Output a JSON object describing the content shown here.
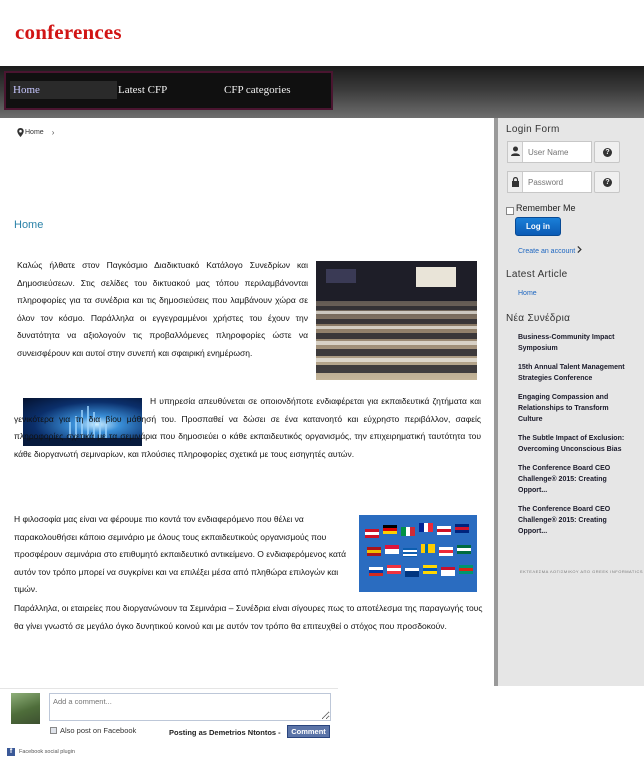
{
  "header": {
    "logo_text": "conferences"
  },
  "nav": {
    "items": [
      "Home",
      "Latest CFP",
      "CFP categories"
    ]
  },
  "breadcrumb": {
    "items": [
      "Home"
    ],
    "separator": "›"
  },
  "main": {
    "title": "Home",
    "paragraphs": [
      "Καλώς ήλθατε στον Παγκόσμιο Διαδικτυακό Κατάλογο Συνεδρίων και Δημοσιεύσεων. Στις σελίδες του δικτυακού μας τόπου περιλαμβάνονται πληροφορίες για τα συνέδρια και τις δημοσιεύσεις που λαμβάνουν χώρα σε όλον τον κόσμο. Παράλληλα οι εγγεγραμμένοι χρήστες του έχουν την δυνατότητα να αξιολογούν τις προβαλλόμενες πληροφορίες ώστε να συνεισφέρουν και αυτοί στην συνεπή και σφαιρική ενημέρωση.",
      "Η υπηρεσία απευθύνεται σε οποιονδήποτε ενδιαφέρεται για εκπαιδευτικά ζητήματα και γενικότερα για τη δια βίου μάθησή του. Προσπαθεί να δώσει σε ένα κατανοητό και εύχρηστο περιβάλλον, σαφείς πληροφορίες σχετικά με τα σεμινάρια που δημοσιεύει ο κάθε εκπαιδευτικός οργανισμός, την επιχειρηματική ταυτότητα του κάθε διοργανωτή σεμιναρίων, και πλούσιες πληροφορίες σχετικά με τους εισηγητές αυτών.",
      " Η φιλοσοφία μας είναι να φέρουμε πιο κοντά τον ενδιαφερόμενο που θέλει να παρακολουθήσει κάποιο σεμινάριο με όλους τους εκπαιδευτικούς οργανισμούς που προσφέρουν σεμινάρια στο επιθυμητό εκπαιδευτικό αντικείμενο. Ο ενδιαφερόμενος κατά αυτόν τον τρόπο μπορεί να συγκρίνει και να επιλέξει μέσα από πληθώρα επιλογών και τιμών.",
      "Παράλληλα, οι εταιρείες που διοργανώνουν τα Σεμινάρια – Συνέδρια είναι σίγουρες πως το αποτέλεσμα της παραγωγής τους θα γίνει γνωστό σε μεγάλο όγκο δυνητικού κοινού και με αυτόν τον τρόπο θα επιτευχθεί ο στόχος που προσδοκούν."
    ]
  },
  "comments": {
    "placeholder": "Add a comment...",
    "also_post": "Also post on Facebook",
    "posting_as": "Posting as Demetrios Ntontos -",
    "button": "Comment",
    "plugin_label": "Facebook social plugin"
  },
  "sidebar": {
    "login_heading": "Login Form",
    "username_placeholder": "User Name",
    "password_placeholder": "Password",
    "remember_me": "Remember Me",
    "login_button": "Log in",
    "create_account": "Create an account",
    "latest_heading": "Latest Article",
    "latest_link": "Home",
    "new_conf_heading": "Νέα Συνέδρια",
    "conferences": [
      "Business-Community Impact Symposium",
      "15th Annual Talent Management Strategies Conference",
      "Engaging Compassion and Relationships to Transform Culture",
      "The Subtle Impact of Exclusion: Overcoming Unconscious Bias",
      "The Conference Board CEO Challenge® 2015: Creating Opport...",
      "The Conference Board CEO Challenge® 2015: Creating Opport..."
    ],
    "footer_text": "ΕΚΤΕΛΕΣΜΑ ΛΟΓΙΣΜΙΚΟΥ ΑΠΟ GREEK INFORMATICS"
  }
}
